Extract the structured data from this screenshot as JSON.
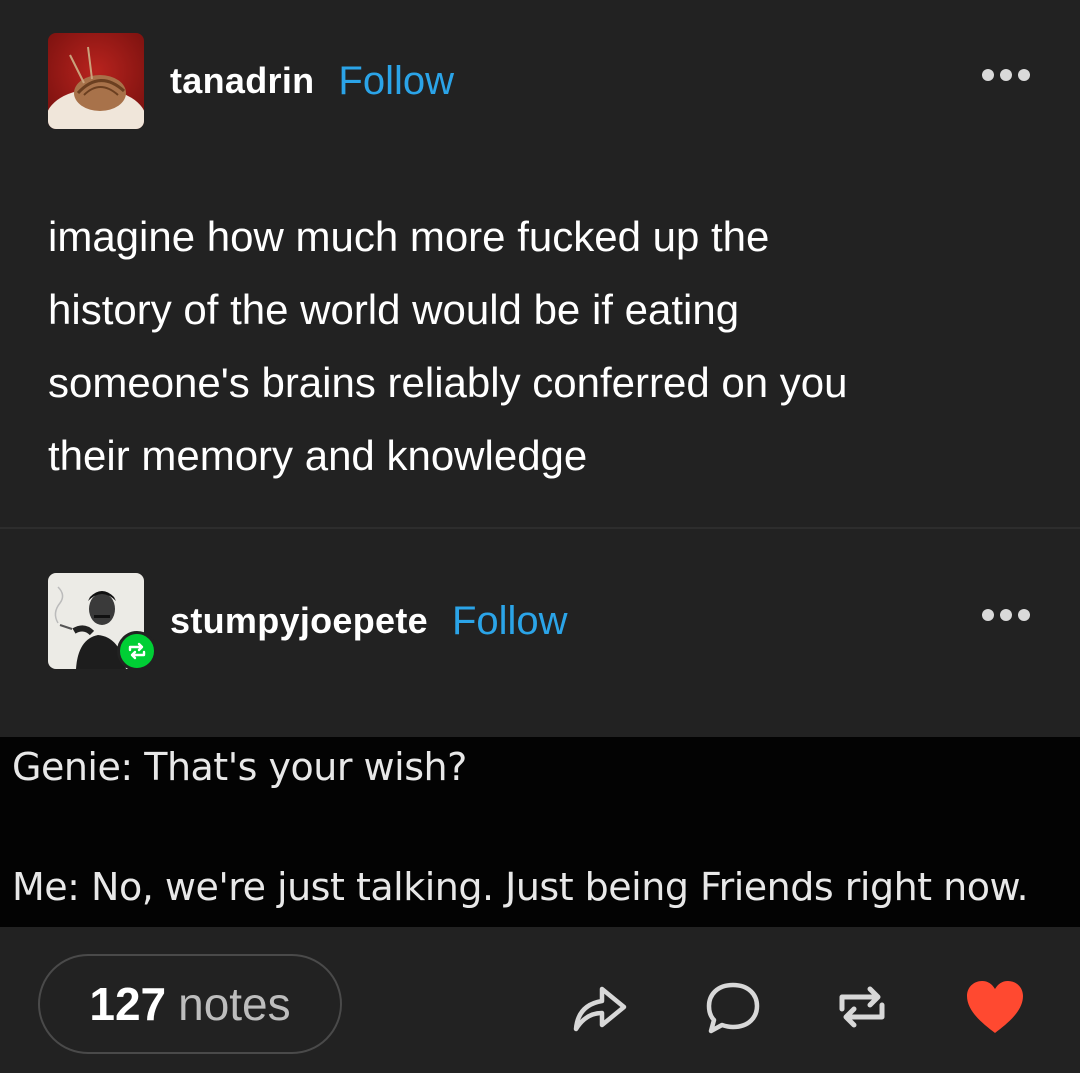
{
  "post1": {
    "username": "tanadrin",
    "follow_label": "Follow",
    "body_lines": [
      "imagine how much more fucked up the",
      "history of the world would be if eating",
      "someone's brains reliably conferred on you",
      "their memory and knowledge"
    ]
  },
  "post2": {
    "username": "stumpyjoepete",
    "follow_label": "Follow",
    "meme_lines": [
      "Genie: That's your wish?",
      "Me: No, we're just talking. Just being Friends right now."
    ]
  },
  "footer": {
    "notes_count": "127",
    "notes_label": "notes"
  },
  "colors": {
    "background": "#222222",
    "follow": "#2ba4e8",
    "reblog_badge": "#00cf35",
    "like_heart": "#ff4930"
  },
  "icons": [
    "more-options-icon",
    "reblog-badge-icon",
    "share-icon",
    "reply-icon",
    "reblog-icon",
    "like-heart-icon"
  ]
}
